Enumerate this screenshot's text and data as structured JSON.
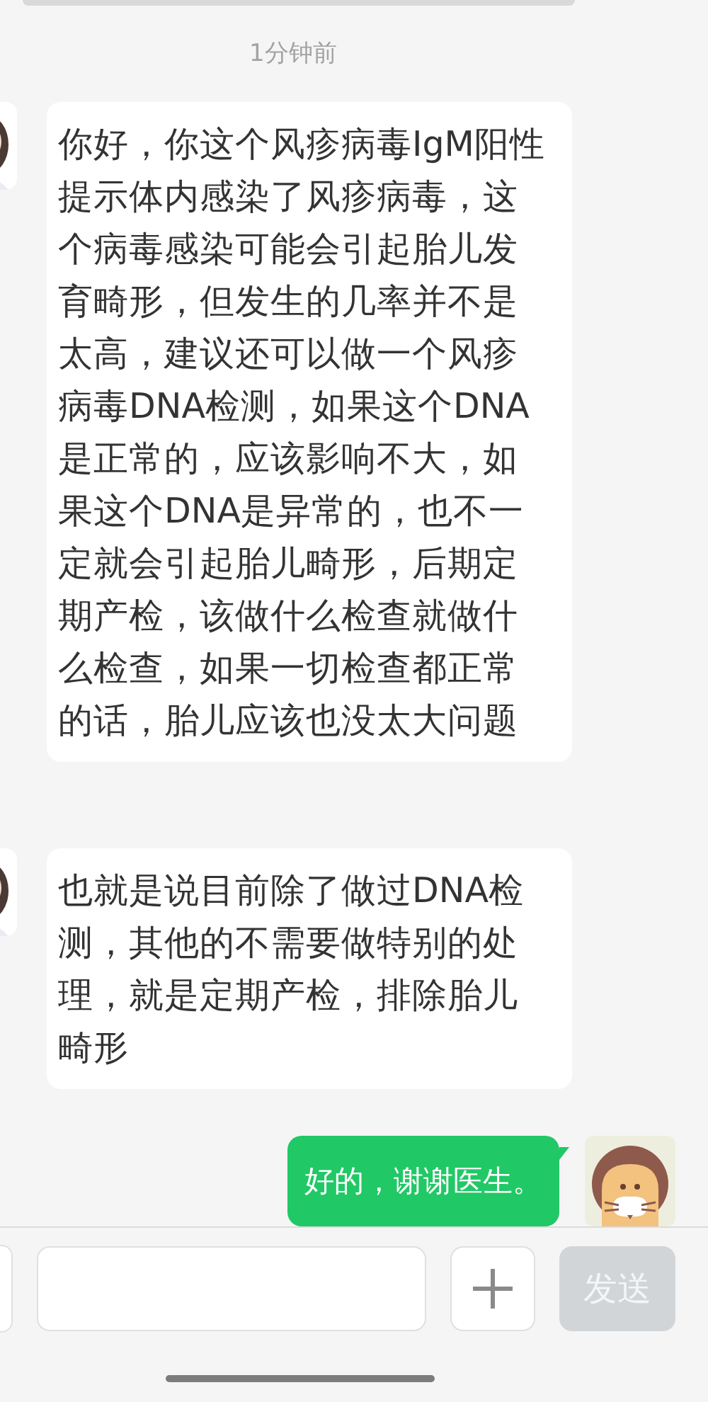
{
  "messages": [
    {
      "kind": "timestamp",
      "text": "1分钟前"
    },
    {
      "kind": "received",
      "text": "你好，你这个风疹病毒IgM阳性提示体内感染了风疹病毒，这个病毒感染可能会引起胎儿发育畸形，但发生的几率并不是太高，建议还可以做一个风疹病毒DNA检测，如果这个DNA是正常的，应该影响不大，如果这个DNA是异常的，也不一定就会引起胎儿畸形，后期定期产检，该做什么检查就做什么检查，如果一切检查都正常的话，胎儿应该也没太大问题"
    },
    {
      "kind": "received",
      "text": "也就是说目前除了做过DNA检测，其他的不需要做特别的处理，就是定期产检，排除胎儿畸形"
    },
    {
      "kind": "sent",
      "text": "好的，谢谢医生。"
    }
  ],
  "composer": {
    "send_button": {
      "label": "发送",
      "disabled": true
    }
  }
}
